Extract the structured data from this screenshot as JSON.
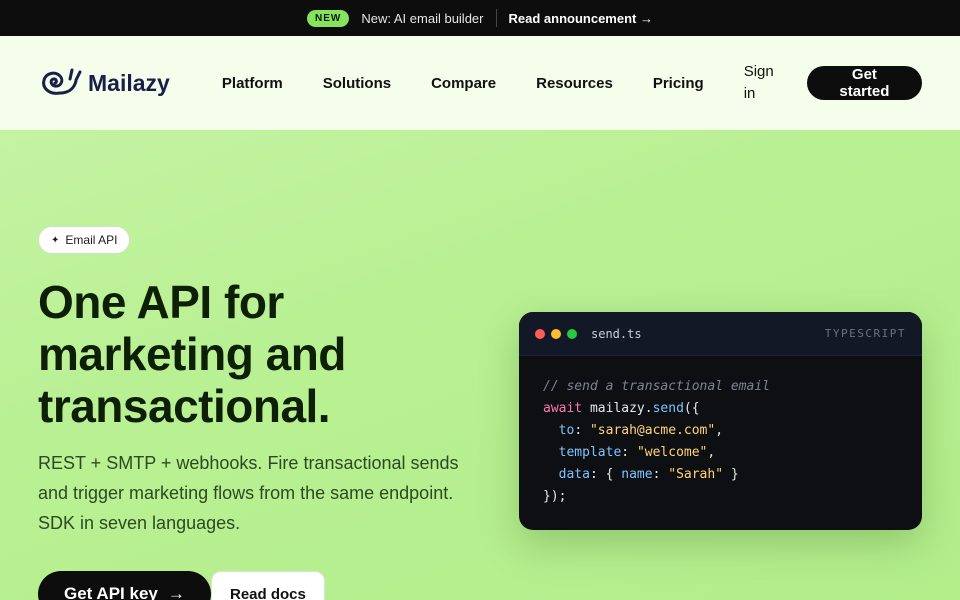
{
  "announcement": {
    "badge": "NEW",
    "text": "New: AI email builder",
    "link": "Read announcement →"
  },
  "nav": {
    "logo_text": "Mailazy",
    "items": [
      "Platform",
      "Solutions",
      "Compare",
      "Resources",
      "Pricing"
    ],
    "signin": "Sign in",
    "cta": "Get started"
  },
  "hero": {
    "pill": "Email API",
    "pill_icon": "sparkle-icon",
    "headline": "One API for marketing and transactional.",
    "sub": "REST + SMTP + webhooks. Fire transactional sends and trigger marketing flows from the same endpoint. SDK in seven languages.",
    "primary_cta": "Get API key",
    "primary_arrow": "→",
    "secondary_cta": "Read docs"
  },
  "code": {
    "filename": "send.ts",
    "language": "TYPESCRIPT",
    "comment": "// send a transactional email",
    "kw_await": "await",
    "call": " mailazy.",
    "fn": "send",
    "open": "({",
    "to_key": "to",
    "to_val": "\"sarah@acme.com\"",
    "template_key": "template",
    "template_val": "\"welcome\"",
    "data_key": "data",
    "name_key": "name",
    "name_val": "\"Sarah\"",
    "close": "});"
  },
  "colors": {
    "accent": "#86e35c",
    "hero_bg": "#b6ef8f",
    "nav_bg": "#f5fdeb",
    "dark": "#0d0d0d",
    "dot_red": "#ff5f57",
    "dot_yellow": "#febc2e",
    "dot_green": "#28c840"
  }
}
